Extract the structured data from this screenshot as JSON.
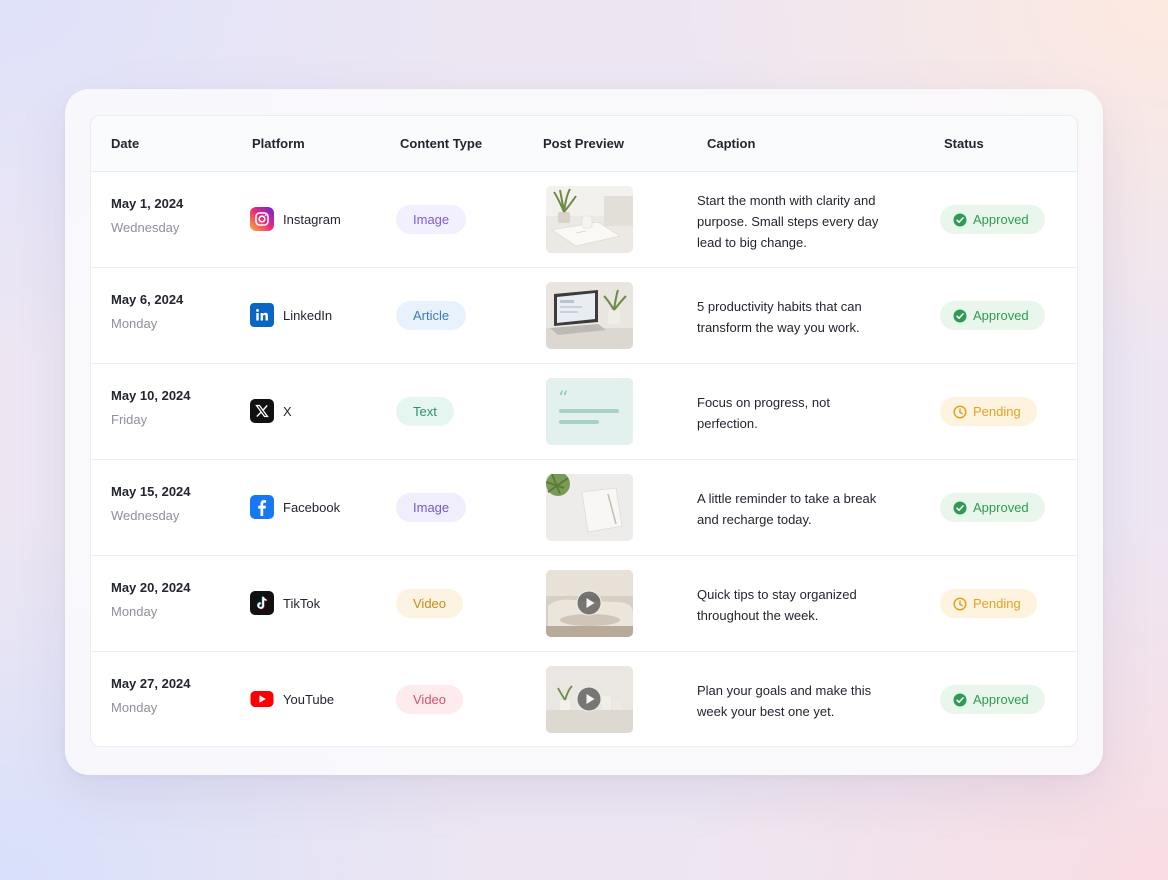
{
  "headers": {
    "date": "Date",
    "platform": "Platform",
    "content_type": "Content Type",
    "post_preview": "Post Preview",
    "caption": "Caption",
    "status": "Status"
  },
  "rows": [
    {
      "date": "May 1, 2024",
      "weekday": "Wednesday",
      "platform": "Instagram",
      "platform_icon": "instagram-icon",
      "content_type": "Image",
      "type_bg": "#f2efff",
      "type_color": "#7a5fd3",
      "preview": "desk-plant-notebook",
      "caption": "Start the month with clarity and purpose. Small steps every day lead to big change.",
      "status": "Approved",
      "status_icon": "check-circle-icon"
    },
    {
      "date": "May 6, 2024",
      "weekday": "Monday",
      "platform": "LinkedIn",
      "platform_icon": "linkedin-icon",
      "content_type": "Article",
      "type_bg": "#e8f2fc",
      "type_color": "#3f79b8",
      "preview": "laptop-desk",
      "caption": "5 productivity habits that can transform the way you work.",
      "status": "Approved",
      "status_icon": "check-circle-icon"
    },
    {
      "date": "May 10, 2024",
      "weekday": "Friday",
      "platform": "X",
      "platform_icon": "x-icon",
      "content_type": "Text",
      "type_bg": "#e5f5f0",
      "type_color": "#2f8f72",
      "preview": "quote-text",
      "caption": "Focus on progress, not perfection.",
      "status": "Pending",
      "status_icon": "clock-icon"
    },
    {
      "date": "May 15, 2024",
      "weekday": "Wednesday",
      "platform": "Facebook",
      "platform_icon": "facebook-icon",
      "content_type": "Image",
      "type_bg": "#f0eefc",
      "type_color": "#6c5fc4",
      "preview": "notebook-plant-top",
      "caption": "A little reminder to take a break and recharge today.",
      "status": "Approved",
      "status_icon": "check-circle-icon"
    },
    {
      "date": "May 20, 2024",
      "weekday": "Monday",
      "platform": "TikTok",
      "platform_icon": "tiktok-icon",
      "content_type": "Video",
      "type_bg": "#fdf3e2",
      "type_color": "#c98a1e",
      "preview": "sofa-video",
      "caption": "Quick tips to stay organized throughout the week.",
      "status": "Pending",
      "status_icon": "clock-icon"
    },
    {
      "date": "May 27, 2024",
      "weekday": "Monday",
      "platform": "YouTube",
      "platform_icon": "youtube-icon",
      "content_type": "Video",
      "type_bg": "#fdebee",
      "type_color": "#d9506a",
      "preview": "shelf-video",
      "caption": "Plan your goals and make this week your best one yet.",
      "status": "Approved",
      "status_icon": "check-circle-icon"
    }
  ],
  "colors": {
    "approved_bg": "#e9f6ec",
    "approved_text": "#2f9a53",
    "pending_bg": "#fdf3de",
    "pending_text": "#e0a229"
  }
}
